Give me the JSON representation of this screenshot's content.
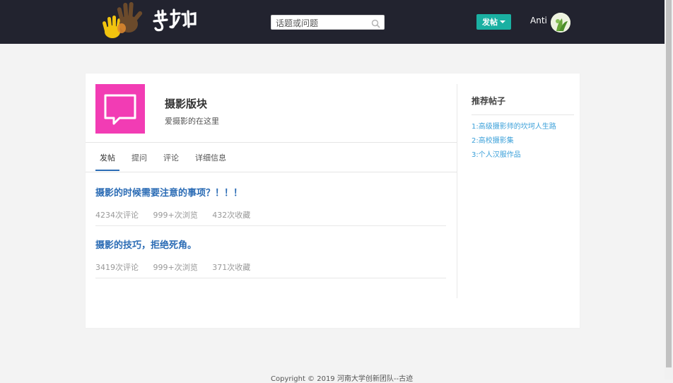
{
  "header": {
    "search_placeholder": "话题或问题",
    "post_button_label": "发帖",
    "username": "Anti"
  },
  "section": {
    "title": "摄影版块",
    "description": "爱摄影的在这里"
  },
  "tabs": [
    {
      "label": "发帖",
      "active": true
    },
    {
      "label": "提问",
      "active": false
    },
    {
      "label": "评论",
      "active": false
    },
    {
      "label": "详细信息",
      "active": false
    }
  ],
  "posts": [
    {
      "title": "摄影的时候需要注意的事项？！！！",
      "comments": "4234次评论",
      "views": "999+次浏览",
      "favorites": "432次收藏"
    },
    {
      "title": "摄影的技巧，拒绝死角。",
      "comments": "3419次评论",
      "views": "999+次浏览",
      "favorites": "371次收藏"
    }
  ],
  "recommended": {
    "title": "推荐帖子",
    "items": [
      "1:高级摄影师的坎坷人生路",
      "2:高校摄影集",
      "3:个人汉服作品"
    ]
  },
  "footer": {
    "text": "Copyright © 2019  河南大学创新团队--古迹"
  },
  "colors": {
    "header_bg": "#22232f",
    "accent": "#1ab0a2",
    "link": "#2b6cb5",
    "section_icon_bg": "#f23cb4"
  }
}
